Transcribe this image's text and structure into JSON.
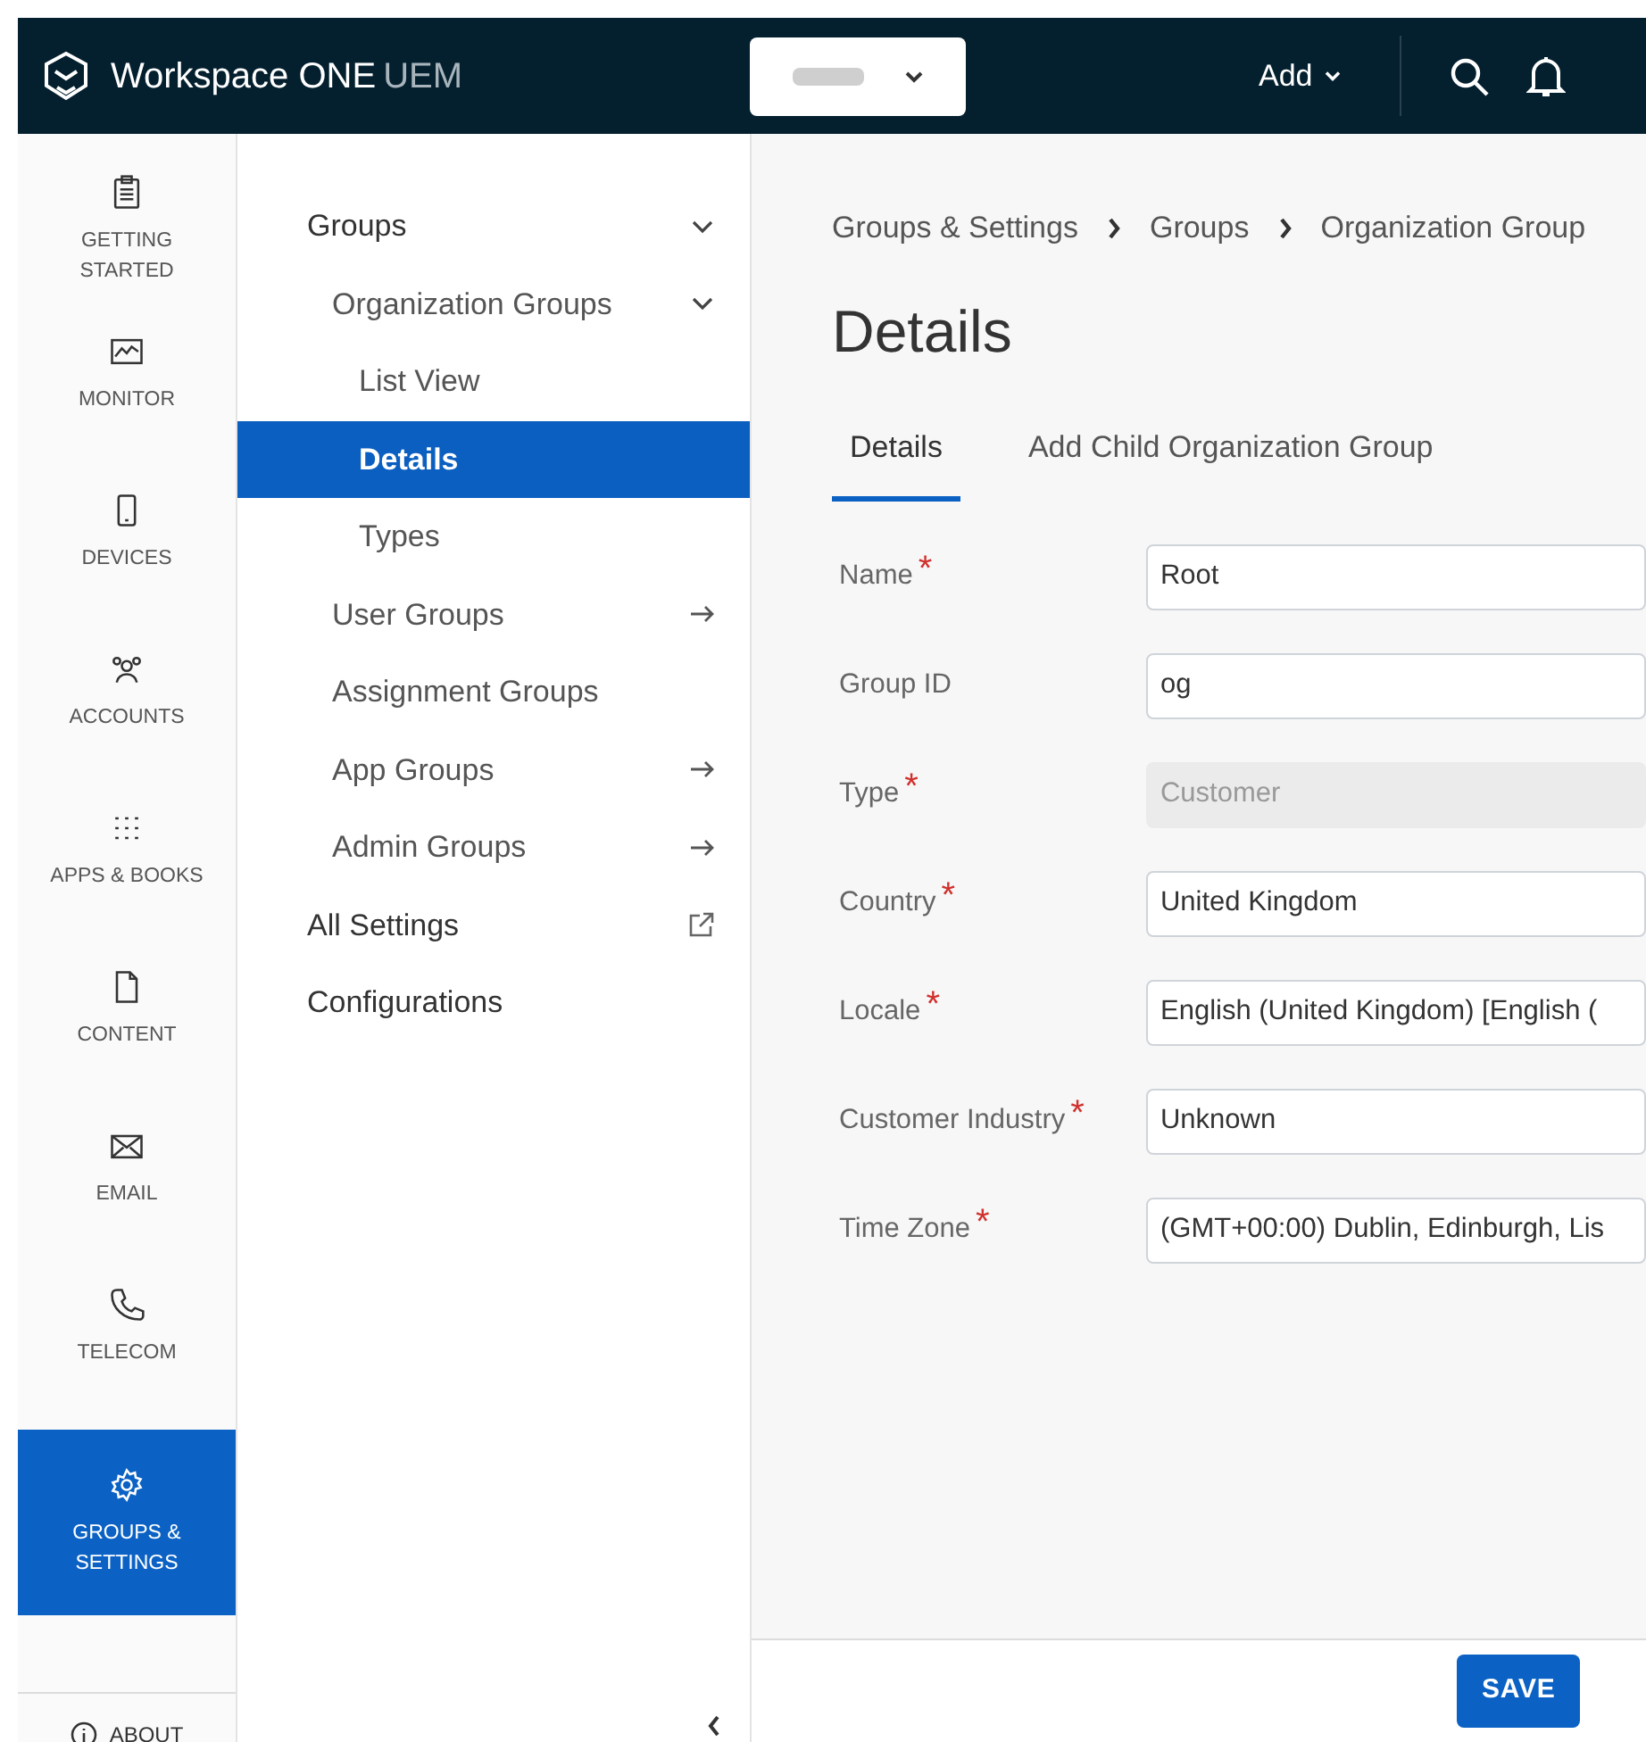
{
  "header": {
    "brand": "Workspace ONE",
    "brand_suffix": "UEM",
    "add_label": "Add"
  },
  "main_nav": [
    {
      "label": "GETTING STARTED",
      "selected": false
    },
    {
      "label": "MONITOR",
      "selected": false
    },
    {
      "label": "DEVICES",
      "selected": false
    },
    {
      "label": "ACCOUNTS",
      "selected": false
    },
    {
      "label": "APPS & BOOKS",
      "selected": false
    },
    {
      "label": "CONTENT",
      "selected": false
    },
    {
      "label": "EMAIL",
      "selected": false
    },
    {
      "label": "TELECOM",
      "selected": false
    },
    {
      "label": "GROUPS & SETTINGS",
      "selected": true
    }
  ],
  "about": "ABOUT",
  "menu": [
    {
      "label": "Groups",
      "expanded": true,
      "selected": false,
      "children": [
        {
          "label": "Organization Groups",
          "expanded": true,
          "selected": false,
          "children": [
            {
              "label": "List View",
              "selected": false
            },
            {
              "label": "Details",
              "selected": true
            },
            {
              "label": "Types",
              "selected": false
            }
          ]
        },
        {
          "label": "User Groups",
          "kind": "arrow",
          "selected": false
        },
        {
          "label": "Assignment Groups",
          "selected": false
        },
        {
          "label": "App Groups",
          "kind": "arrow",
          "selected": false
        },
        {
          "label": "Admin Groups",
          "kind": "arrow",
          "selected": false
        }
      ]
    },
    {
      "label": "All Settings",
      "kind": "external",
      "selected": false
    },
    {
      "label": "Configurations",
      "selected": false
    }
  ],
  "breadcrumb": [
    "Groups & Settings",
    "Groups",
    "Organization Group"
  ],
  "title": "Details",
  "tabs": [
    {
      "label": "Details",
      "selected": true
    },
    {
      "label": "Add Child Organization Group",
      "selected": false
    }
  ],
  "fields": [
    {
      "label": "Name",
      "required": true,
      "value": "Root",
      "disabled": false
    },
    {
      "label": "Group ID",
      "required": false,
      "value": "og",
      "disabled": false
    },
    {
      "label": "Type",
      "required": true,
      "value": "Customer",
      "disabled": true
    },
    {
      "label": "Country",
      "required": true,
      "value": "United Kingdom",
      "disabled": false
    },
    {
      "label": "Locale",
      "required": true,
      "value": "English (United Kingdom) [English (",
      "disabled": false
    },
    {
      "label": "Customer Industry",
      "required": true,
      "value": "Unknown",
      "disabled": false
    },
    {
      "label": "Time Zone",
      "required": true,
      "value": "(GMT+00:00) Dublin, Edinburgh, Lis",
      "disabled": false
    }
  ],
  "required_mark": "*",
  "save_button": "SAVE"
}
